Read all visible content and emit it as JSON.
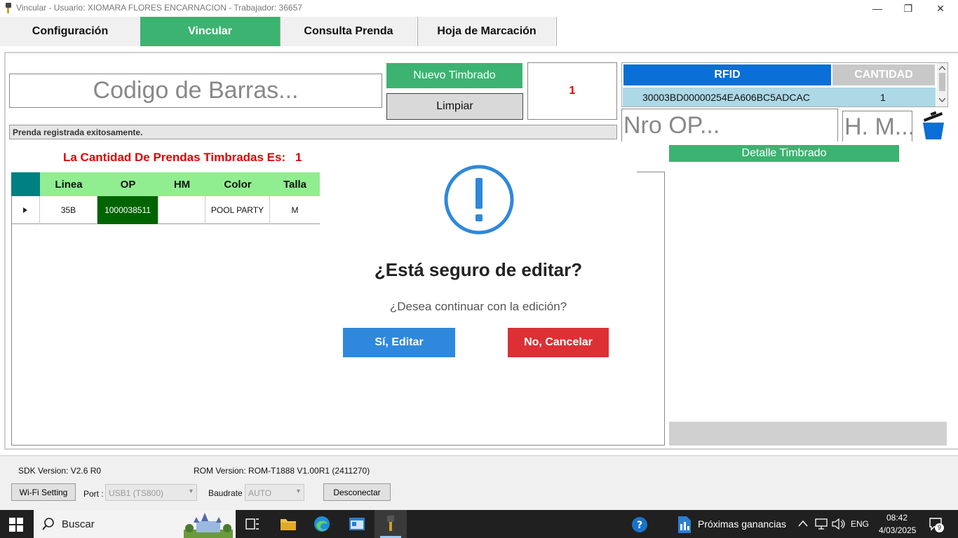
{
  "window": {
    "title": "Vincular - Usuario: XIOMARA FLORES ENCARNACION - Trabajador: 36657",
    "minimize": "—",
    "restore": "❐",
    "close": "✕"
  },
  "tabs": [
    {
      "label": "Configuración",
      "active": false
    },
    {
      "label": "Vincular",
      "active": true
    },
    {
      "label": "Consulta Prenda",
      "active": false
    },
    {
      "label": "Hoja de Marcación",
      "active": false
    }
  ],
  "main": {
    "barcode_placeholder": "Codigo de Barras...",
    "nuevo_timbrado": "Nuevo Timbrado",
    "limpiar": "Limpiar",
    "counter": "1",
    "status_message": "Prenda registrada exitosamente.",
    "quantity_label": "La Cantidad De Prendas Timbradas Es:",
    "quantity_value": "1"
  },
  "rfid": {
    "headers": [
      "RFID",
      "CANTIDAD"
    ],
    "rows": [
      {
        "rfid": "30003BD00000254EA606BC5ADCAC",
        "cantidad": "1"
      }
    ]
  },
  "inputs": {
    "op_placeholder": "Nro OP...",
    "hm_placeholder": "H. M..."
  },
  "detalle": {
    "label": "Detalle Timbrado"
  },
  "grid": {
    "headers": [
      "Linea",
      "OP",
      "HM",
      "Color",
      "Talla"
    ],
    "rows": [
      {
        "linea": "35B",
        "op": "1000038511",
        "hm": "",
        "color": "POOL PARTY",
        "talla": "M"
      }
    ]
  },
  "modal": {
    "title": "¿Está seguro de editar?",
    "text": "¿Desea continuar con la edición?",
    "confirm": "Sí, Editar",
    "cancel": "No, Cancelar"
  },
  "device": {
    "sdk_version": "SDK Version: V2.6 R0",
    "rom_version": "ROM Version: ROM-T1888 V1.00R1 (2411270)",
    "wifi_button": "Wi-Fi Setting",
    "port_label": "Port :",
    "port_value": "USB1 (TS800)",
    "baud_label": "Baudrate :",
    "baud_value": "AUTO",
    "disconnect": "Desconectar"
  },
  "taskbar": {
    "search": "Buscar",
    "widget_text": "Próximas ganancias",
    "language": "ENG",
    "time": "08:42",
    "date": "4/03/2025",
    "notifications": "9"
  },
  "colors": {
    "green": "#3cb371",
    "blue": "#0a6fd6",
    "red": "#dc3035",
    "confirm_blue": "#2f88dc",
    "op_cell": "#006400"
  }
}
